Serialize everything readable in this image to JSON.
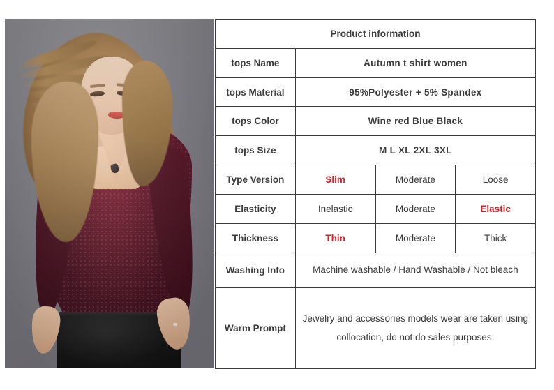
{
  "photo": {
    "alt": "model-wearing-wine-red-v-neck-top",
    "background_color": "#82818a",
    "garment_color": "#4c1020",
    "skirt_color": "#141414"
  },
  "colors": {
    "accent_red": "#d81f26",
    "border": "#3a3a3a",
    "label_text": "#2e2e2e",
    "option_text": "#4a4a4a"
  },
  "table": {
    "header": "Product information",
    "rows": [
      {
        "label": "tops Name",
        "type": "single",
        "value": "Autumn t shirt women",
        "highlight": true
      },
      {
        "label": "tops Material",
        "type": "single",
        "value": "95%Polyester + 5% Spandex",
        "highlight": true
      },
      {
        "label": "tops Color",
        "type": "single",
        "value": "Wine red   Blue   Black",
        "highlight": true
      },
      {
        "label": "tops Size",
        "type": "single",
        "value": "M    L    XL    2XL   3XL",
        "highlight": true
      },
      {
        "label": "Type Version",
        "type": "options",
        "options": [
          "Slim",
          "Moderate",
          "Loose"
        ],
        "selected": 0
      },
      {
        "label": "Elasticity",
        "type": "options",
        "options": [
          "Inelastic",
          "Moderate",
          "Elastic"
        ],
        "selected": 2
      },
      {
        "label": "Thickness",
        "type": "options",
        "options": [
          "Thin",
          "Moderate",
          "Thick"
        ],
        "selected": 0
      },
      {
        "label": "Washing Info",
        "type": "single",
        "value": "Machine washable / Hand Washable / Not bleach",
        "highlight": false
      },
      {
        "label": "Warm Prompt",
        "type": "single",
        "value": "Jewelry and accessories models wear are taken using collocation, do not do sales purposes.",
        "highlight": false
      }
    ]
  }
}
